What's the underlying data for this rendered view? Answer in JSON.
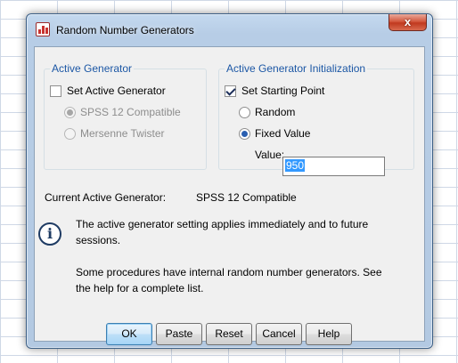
{
  "window": {
    "title": "Random Number Generators",
    "close_glyph": "x"
  },
  "active_generator": {
    "legend": "Active Generator",
    "set_active_label": "Set Active Generator",
    "set_active_checked": false,
    "options": [
      {
        "label": "SPSS 12 Compatible",
        "selected": true,
        "enabled": false
      },
      {
        "label": "Mersenne Twister",
        "selected": false,
        "enabled": false
      }
    ]
  },
  "initialization": {
    "legend": "Active Generator Initialization",
    "set_start_label": "Set Starting Point",
    "set_start_checked": true,
    "options": [
      {
        "label": "Random",
        "selected": false,
        "enabled": true
      },
      {
        "label": "Fixed Value",
        "selected": true,
        "enabled": true
      }
    ],
    "value_label": "Value:",
    "value": "950"
  },
  "current": {
    "label": "Current Active Generator:",
    "value": "SPSS 12 Compatible"
  },
  "info": {
    "icon": "info-icon",
    "line1": "The active generator setting applies immediately and to future",
    "line2": "sessions.",
    "line3": "Some procedures have internal random number generators.  See",
    "line4": "the help for a complete list."
  },
  "buttons": {
    "ok": "OK",
    "paste": "Paste",
    "reset": "Reset",
    "cancel": "Cancel",
    "help": "Help"
  },
  "colors": {
    "group_title": "#1c57a5",
    "close_button": "#c0391f",
    "selection": "#3399ff"
  }
}
